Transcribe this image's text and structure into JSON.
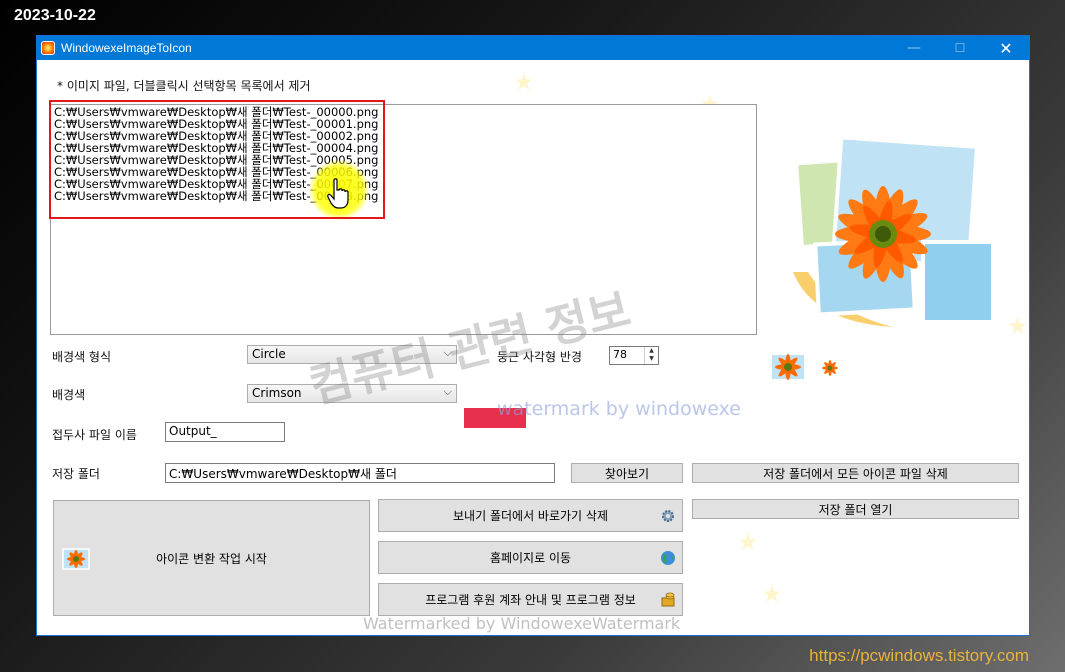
{
  "overlay": {
    "date": "2023-10-22",
    "site": "https://pcwindows.tistory.com"
  },
  "window": {
    "title": "WindowexeImageToIcon",
    "controls": {
      "minimize": "—",
      "maximize": "☐",
      "close": "✕"
    }
  },
  "instruction": "* 이미지 파일, 더블클릭시 선택항목 목록에서 제거",
  "file_list": [
    "C:₩Users₩vmware₩Desktop₩새 폴더₩Test-_00000.png",
    "C:₩Users₩vmware₩Desktop₩새 폴더₩Test-_00001.png",
    "C:₩Users₩vmware₩Desktop₩새 폴더₩Test-_00002.png",
    "C:₩Users₩vmware₩Desktop₩새 폴더₩Test-_00004.png",
    "C:₩Users₩vmware₩Desktop₩새 폴더₩Test-_00005.png",
    "C:₩Users₩vmware₩Desktop₩새 폴더₩Test-_00006.png",
    "C:₩Users₩vmware₩Desktop₩새 폴더₩Test-_00007.png",
    "C:₩Users₩vmware₩Desktop₩새 폴더₩Test-_00008.png"
  ],
  "form": {
    "bg_shape_label": "배경색 형식",
    "bg_shape_value": "Circle",
    "radius_label": "둥근 사각형 반경",
    "radius_value": "78",
    "bg_color_label": "배경색",
    "bg_color_value": "Crimson",
    "bg_color_hex": "#e8304e",
    "prefix_label": "접두사 파일 이름",
    "prefix_value": "Output_",
    "save_folder_label": "저장 폴더",
    "save_folder_value": "C:₩Users₩vmware₩Desktop₩새 폴더"
  },
  "buttons": {
    "browse": "찾아보기",
    "delete_all_icons": "저장 폴더에서 모든 아이콘 파일 삭제",
    "open_save_folder": "저장 폴더 열기",
    "start_conversion": "아이콘 변환 작업 시작",
    "delete_shortcut": "보내기 폴더에서 바로가기 삭제",
    "homepage": "홈페이지로 이동",
    "program_info": "프로그램 후원 계좌 안내 및 프로그램 정보"
  },
  "watermarks": {
    "big": "컴퓨터 관련 정보",
    "small": "watermark by windowexe",
    "bottom": "Watermarked by WindowexeWatermark"
  }
}
